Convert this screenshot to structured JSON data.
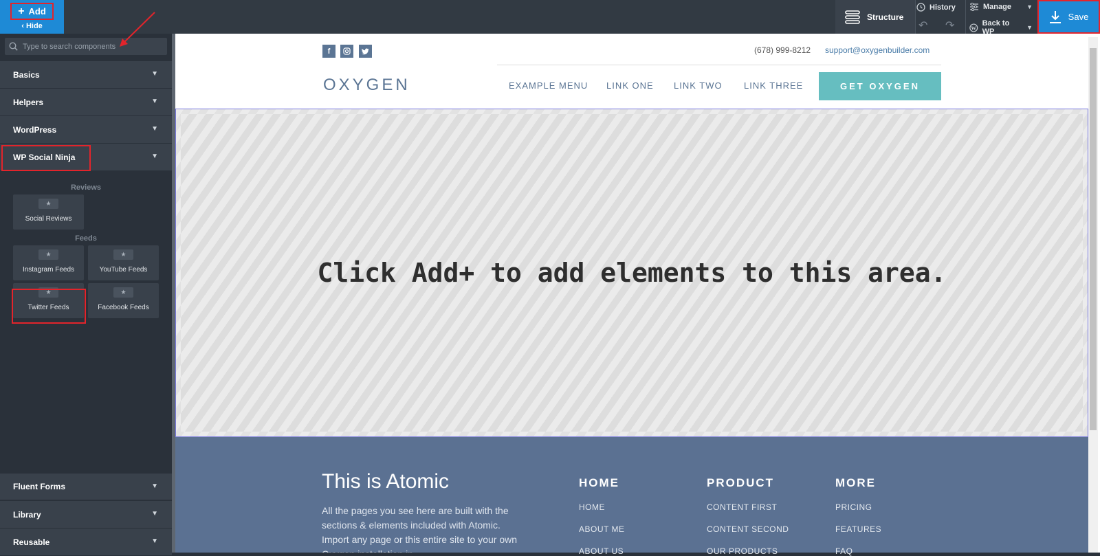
{
  "topbar": {
    "add_label": "Add",
    "hide_label": "Hide",
    "structure_label": "Structure",
    "history_label": "History",
    "manage_label": "Manage",
    "back_to_wp_label": "Back to WP",
    "save_label": "Save"
  },
  "sidebar": {
    "search_placeholder": "Type to search components",
    "sections_top": [
      "Basics",
      "Helpers",
      "WordPress",
      "WP Social Ninja"
    ],
    "groups": {
      "reviews_title": "Reviews",
      "feeds_title": "Feeds",
      "reviews_items": [
        "Social Reviews"
      ],
      "feeds_items": [
        "Instagram Feeds",
        "YouTube Feeds",
        "Twitter Feeds",
        "Facebook Feeds"
      ]
    },
    "sections_bottom": [
      "Fluent Forms",
      "Library",
      "Reusable"
    ]
  },
  "site": {
    "phone": "(678) 999-8212",
    "email": "support@oxygenbuilder.com",
    "logo": "OXYGEN",
    "nav": [
      "EXAMPLE MENU",
      "LINK ONE",
      "LINK TWO",
      "LINK THREE"
    ],
    "cta": "GET OXYGEN",
    "drop_message": "Click Add+ to add elements to this area.",
    "footer": {
      "title": "This is Atomic",
      "body": "All the pages you see here are built with the sections & elements included with Atomic. Import any page or this entire site to your own Oxygen installation in",
      "columns": [
        {
          "heading": "HOME",
          "links": [
            "HOME",
            "ABOUT ME",
            "ABOUT US"
          ]
        },
        {
          "heading": "PRODUCT",
          "links": [
            "CONTENT FIRST",
            "CONTENT SECOND",
            "OUR PRODUCTS"
          ]
        },
        {
          "heading": "MORE",
          "links": [
            "PRICING",
            "FEATURES",
            "FAQ"
          ]
        }
      ]
    }
  },
  "colors": {
    "accent": "#1e8ad6",
    "highlight": "#e3242b",
    "cta": "#66bec0",
    "footer": "#5b7192"
  }
}
